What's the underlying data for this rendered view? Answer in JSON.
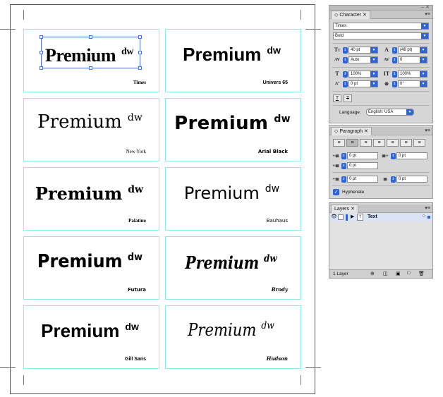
{
  "artboard": {
    "word": "Premium",
    "sup": "dw",
    "cards": [
      {
        "font_label": "Times"
      },
      {
        "font_label": "Univers 65"
      },
      {
        "font_label": "New York"
      },
      {
        "font_label": "Arial Black"
      },
      {
        "font_label": "Palatino"
      },
      {
        "font_label": "Bauhaus"
      },
      {
        "font_label": "Futura"
      },
      {
        "font_label": "Brody"
      },
      {
        "font_label": "Gill Sans"
      },
      {
        "font_label": "Hudson"
      }
    ]
  },
  "character_panel": {
    "tab": "Character",
    "font_family": "Times",
    "font_style": "Bold",
    "font_size": "40 pt",
    "leading": "(48 pt)",
    "kerning": "Auto",
    "tracking": "0",
    "vertical_scale": "100%",
    "horizontal_scale": "100%",
    "baseline_shift": "0 pt",
    "skew": "0°",
    "language_label": "Language:",
    "language": "English: USA"
  },
  "paragraph_panel": {
    "tab": "Paragraph",
    "left_indent": "0 pt",
    "right_indent": "0 pt",
    "first_line_indent": "0 pt",
    "space_before": "0 pt",
    "space_after": "0 pt",
    "hyphenate_label": "Hyphenate",
    "hyphenate_checked": true
  },
  "layers_panel": {
    "tab": "Layers",
    "layer_name": "Text",
    "footer": "1 Layer"
  },
  "colors": {
    "accent": "#2f63d6",
    "card_border": "#8fe8f0",
    "selection": "#4a6fe0",
    "panel_bg": "#d6d6d6"
  }
}
